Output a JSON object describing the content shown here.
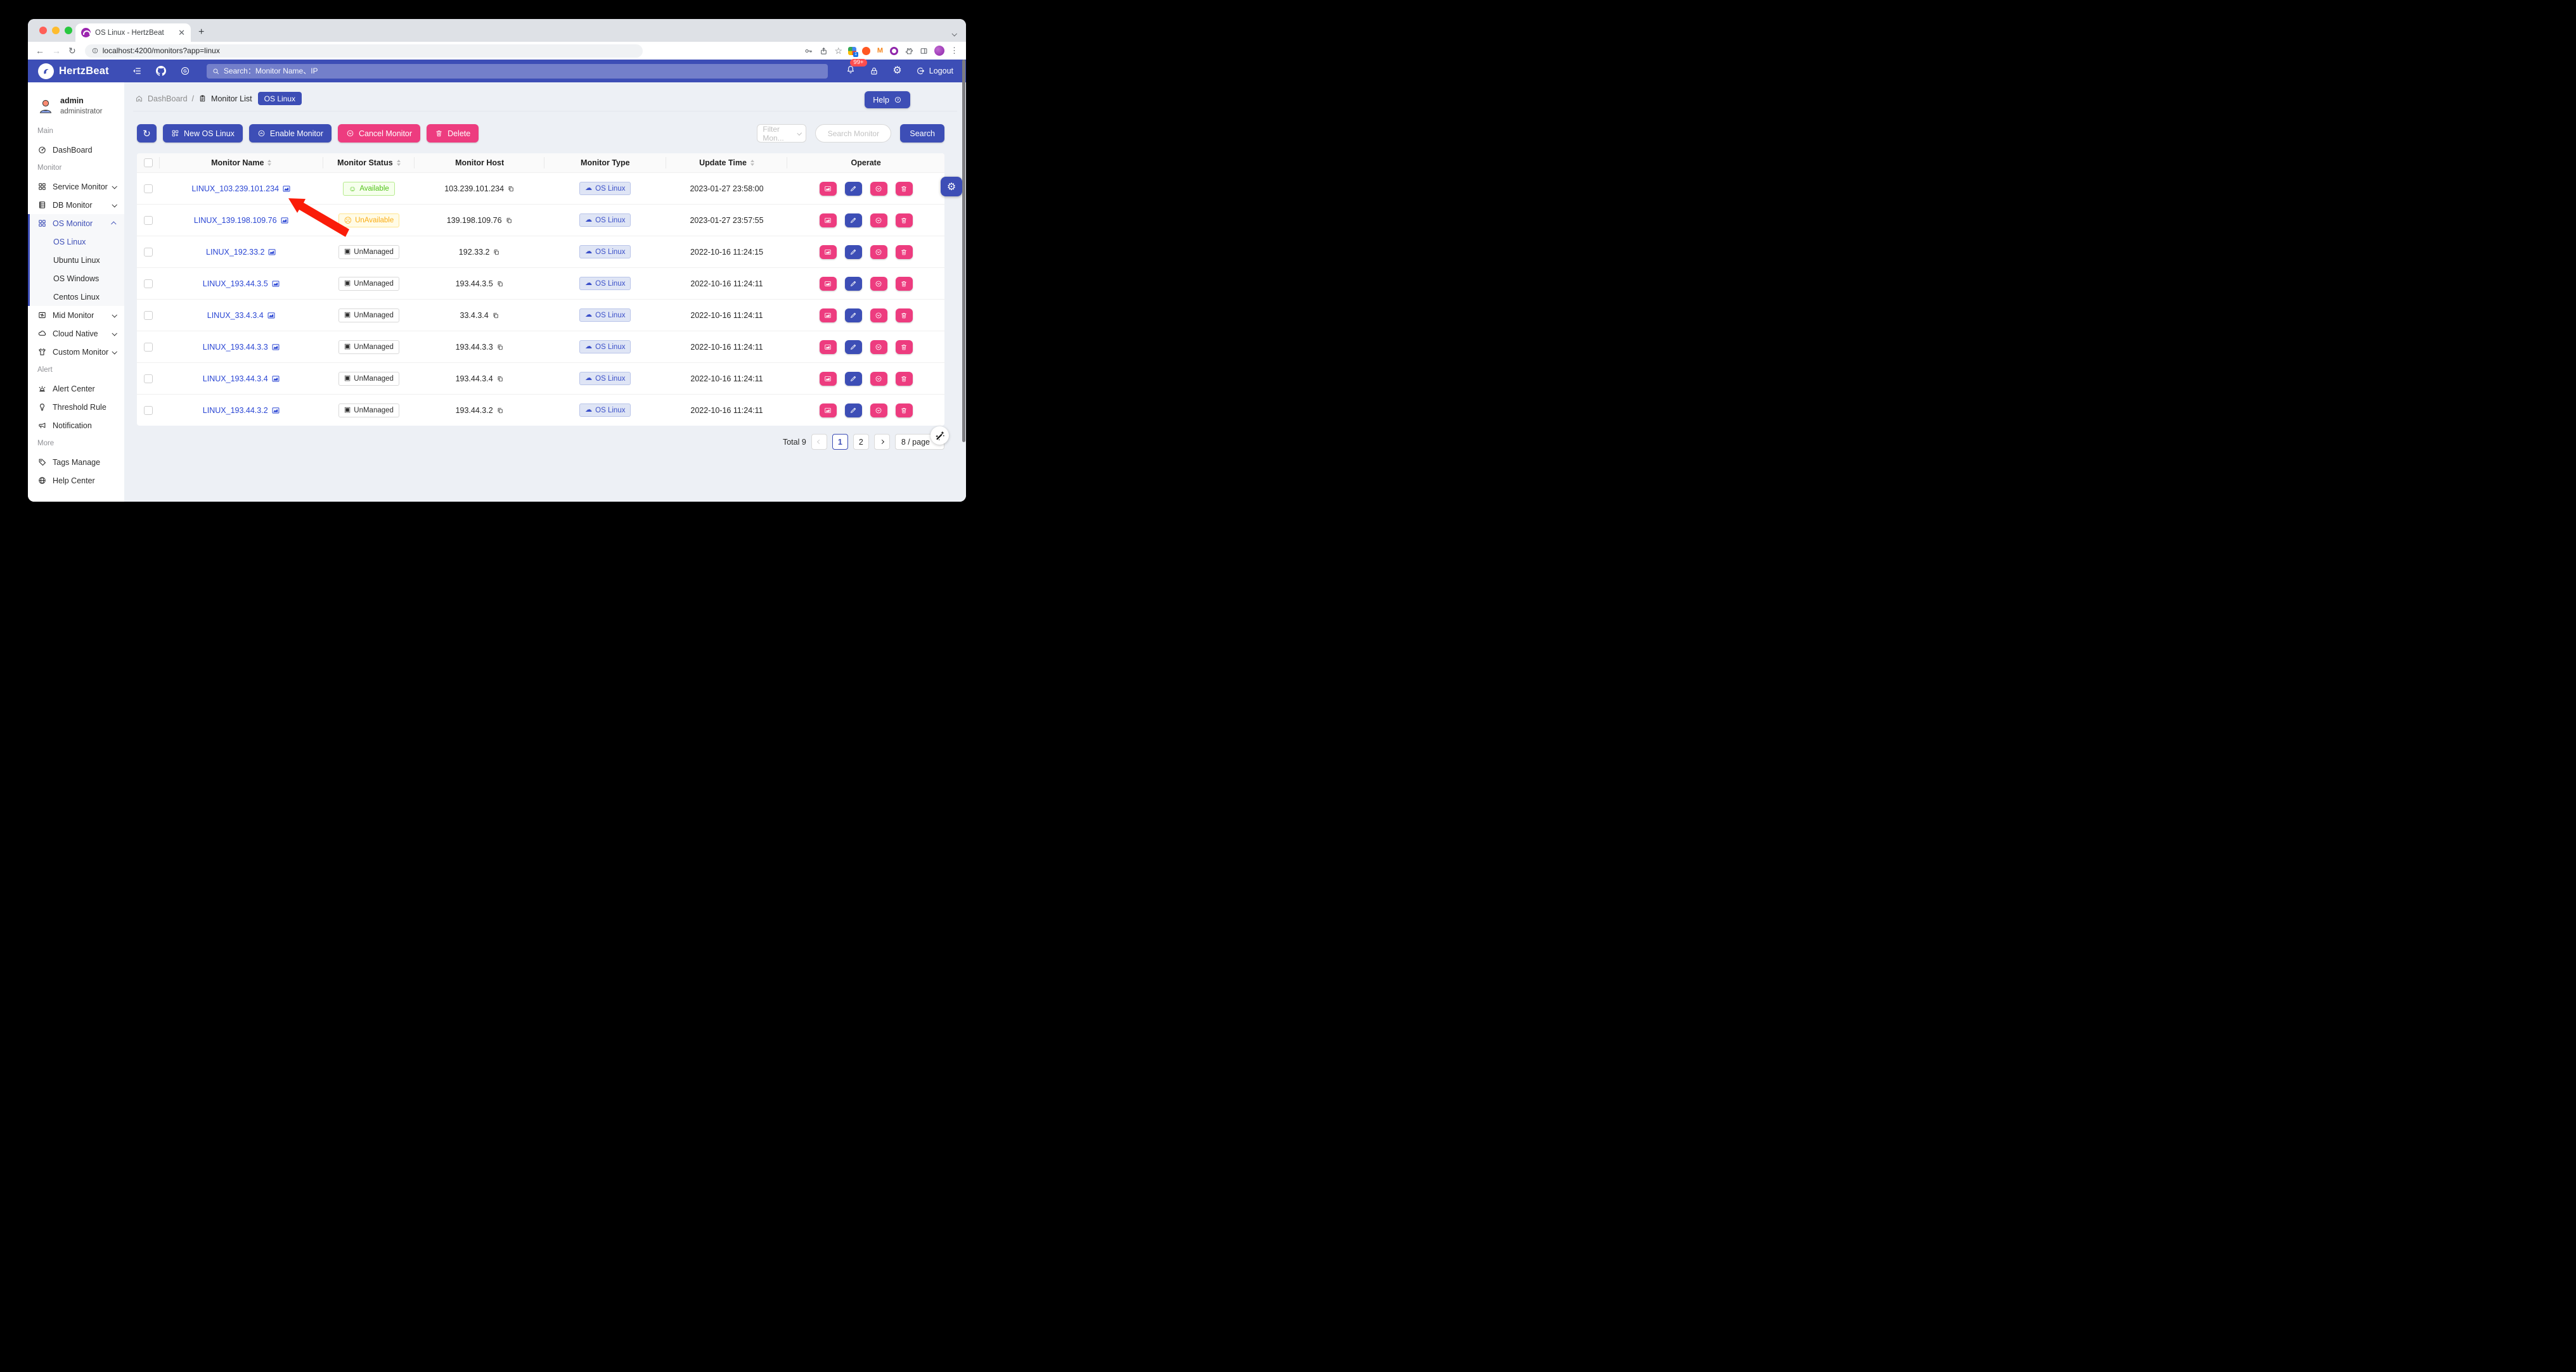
{
  "browser": {
    "tab_title": "OS Linux - HertzBeat",
    "url": "localhost:4200/monitors?app=linux",
    "extension_badge": "1"
  },
  "navbar": {
    "brand": "HertzBeat",
    "search_placeholder": "Search：Monitor Name、IP",
    "notification_badge": "99+",
    "logout_label": "Logout"
  },
  "sidebar": {
    "user": {
      "name": "admin",
      "role": "administrator"
    },
    "sections": [
      {
        "label": "Main",
        "items": [
          {
            "label": "DashBoard",
            "icon": "gauge"
          }
        ]
      },
      {
        "label": "Monitor",
        "items": [
          {
            "label": "Service Monitor",
            "icon": "grid",
            "chevron": "down"
          },
          {
            "label": "DB Monitor",
            "icon": "db",
            "chevron": "down"
          },
          {
            "label": "OS Monitor",
            "icon": "grid",
            "chevron": "up",
            "active": true,
            "children": [
              {
                "label": "OS Linux",
                "active": true
              },
              {
                "label": "Ubuntu Linux"
              },
              {
                "label": "OS Windows"
              },
              {
                "label": "Centos Linux"
              }
            ]
          },
          {
            "label": "Mid Monitor",
            "icon": "mid",
            "chevron": "down"
          },
          {
            "label": "Cloud Native",
            "icon": "cloud",
            "chevron": "down"
          },
          {
            "label": "Custom Monitor",
            "icon": "shirt",
            "chevron": "down"
          }
        ]
      },
      {
        "label": "Alert",
        "items": [
          {
            "label": "Alert Center",
            "icon": "alarm"
          },
          {
            "label": "Threshold Rule",
            "icon": "bulb"
          },
          {
            "label": "Notification",
            "icon": "megaphone"
          }
        ]
      },
      {
        "label": "More",
        "items": [
          {
            "label": "Tags Manage",
            "icon": "tag"
          },
          {
            "label": "Help Center",
            "icon": "globe"
          }
        ]
      }
    ]
  },
  "breadcrumb": {
    "dashboard": "DashBoard",
    "separator": "/",
    "monitor_list": "Monitor List",
    "badge": "OS Linux"
  },
  "help": {
    "label": "Help"
  },
  "toolbar": {
    "new_label": "New OS Linux",
    "enable_label": "Enable Monitor",
    "cancel_label": "Cancel Monitor",
    "delete_label": "Delete",
    "filter_placeholder": "Filter Mon...",
    "search_placeholder": "Search Monitor",
    "search_label": "Search"
  },
  "table": {
    "columns": [
      "Monitor Name",
      "Monitor Status",
      "Monitor Host",
      "Monitor Type",
      "Update Time",
      "Operate"
    ],
    "rows": [
      {
        "name": "LINUX_103.239.101.234",
        "status": {
          "label": "Available",
          "state": "available"
        },
        "host": "103.239.101.234",
        "type": "OS Linux",
        "updated": "2023-01-27 23:58:00"
      },
      {
        "name": "LINUX_139.198.109.76",
        "status": {
          "label": "UnAvailable",
          "state": "unavailable"
        },
        "host": "139.198.109.76",
        "type": "OS Linux",
        "updated": "2023-01-27 23:57:55"
      },
      {
        "name": "LINUX_192.33.2",
        "status": {
          "label": "UnManaged",
          "state": "unmanaged"
        },
        "host": "192.33.2",
        "type": "OS Linux",
        "updated": "2022-10-16 11:24:15"
      },
      {
        "name": "LINUX_193.44.3.5",
        "status": {
          "label": "UnManaged",
          "state": "unmanaged"
        },
        "host": "193.44.3.5",
        "type": "OS Linux",
        "updated": "2022-10-16 11:24:11"
      },
      {
        "name": "LINUX_33.4.3.4",
        "status": {
          "label": "UnManaged",
          "state": "unmanaged"
        },
        "host": "33.4.3.4",
        "type": "OS Linux",
        "updated": "2022-10-16 11:24:11"
      },
      {
        "name": "LINUX_193.44.3.3",
        "status": {
          "label": "UnManaged",
          "state": "unmanaged"
        },
        "host": "193.44.3.3",
        "type": "OS Linux",
        "updated": "2022-10-16 11:24:11"
      },
      {
        "name": "LINUX_193.44.3.4",
        "status": {
          "label": "UnManaged",
          "state": "unmanaged"
        },
        "host": "193.44.3.4",
        "type": "OS Linux",
        "updated": "2022-10-16 11:24:11"
      },
      {
        "name": "LINUX_193.44.3.2",
        "status": {
          "label": "UnManaged",
          "state": "unmanaged"
        },
        "host": "193.44.3.2",
        "type": "OS Linux",
        "updated": "2022-10-16 11:24:11"
      }
    ]
  },
  "pagination": {
    "total_label": "Total 9",
    "page_1": "1",
    "page_2": "2",
    "page_size_label": "8 / page"
  },
  "colors": {
    "primary": "#3d4eb6",
    "pink": "#ed3c7f",
    "link": "#2a46d4",
    "available": "#52c41a",
    "unavailable": "#faad14",
    "notification_badge_bg": "#ff4d4f"
  }
}
